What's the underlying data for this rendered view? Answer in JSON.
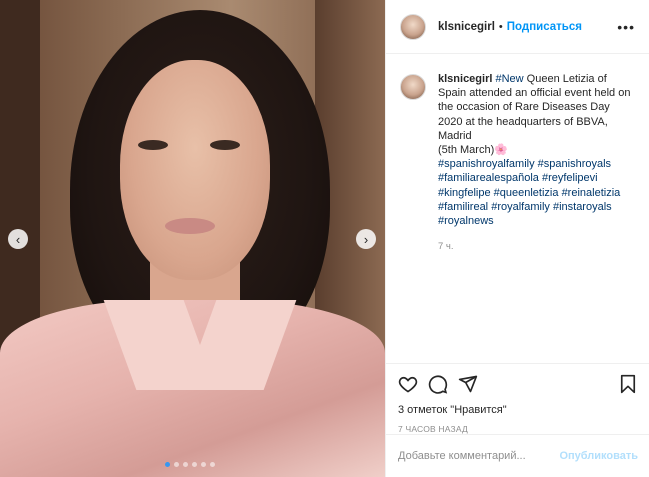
{
  "post": {
    "username": "klsnicegirl",
    "follow_label": "Подписаться",
    "separator": "•",
    "more_label": "•••"
  },
  "caption": {
    "username": "klsnicegirl",
    "segments": [
      {
        "text": "#New",
        "hashtag": true
      },
      {
        "text": " Queen Letizia of Spain attended an official event held on the occasion of Rare Diseases Day 2020 at the headquarters of BBVA, Madrid",
        "hashtag": false
      }
    ],
    "date_line": "(5th March)",
    "flower": "🌸",
    "hashtags": [
      "#spanishroyalfamily",
      "#spanishroyals",
      "#familiarealespañola",
      "#reyfelipevi",
      "#kingfelipe",
      "#queenletizia",
      "#reinaletizia",
      "#familireal",
      "#royalfamily",
      "#instaroyals",
      "#royalnews"
    ],
    "time": "7 ч."
  },
  "carousel": {
    "prev_label": "‹",
    "next_label": "›",
    "slide_count": 6,
    "active_index": 0
  },
  "actions": {
    "likes_text": "3 отметок \"Нравится\"",
    "ago_text": "7 ЧАСОВ НАЗАД",
    "icons": [
      "heart-icon",
      "comment-icon",
      "share-icon",
      "bookmark-icon"
    ]
  },
  "comment": {
    "placeholder": "Добавьте комментарий...",
    "publish_label": "Опубликовать"
  },
  "colors": {
    "link_blue": "#0095f6",
    "hashtag": "#00376b",
    "muted": "#8e8e8e",
    "publish_disabled": "#b2dffc"
  }
}
